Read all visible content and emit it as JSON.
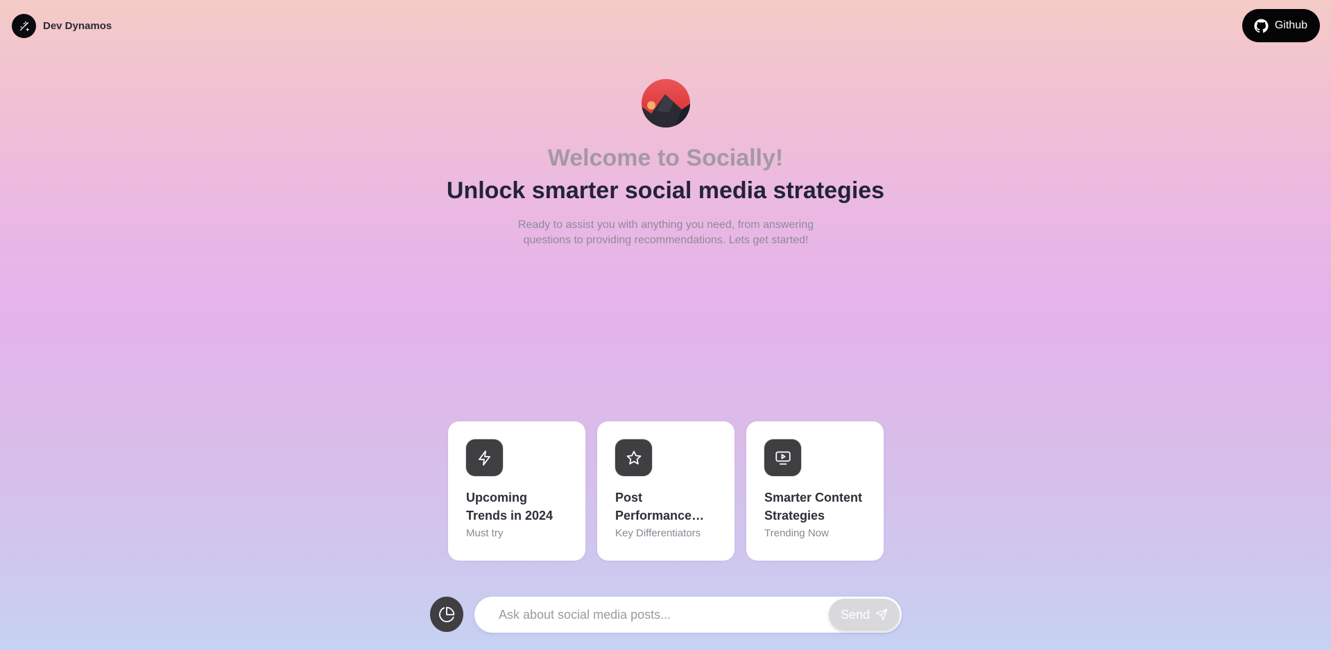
{
  "header": {
    "brand_name": "Dev Dynamos",
    "brand_icon": "magic-wand-icon",
    "github_label": "Github",
    "github_icon": "github-icon"
  },
  "hero": {
    "avatar": "mountain-sunset-avatar",
    "title": "Welcome to Socially!",
    "subtitle": "Unlock smarter social media strategies",
    "description": "Ready to assist you with anything you need, from answering questions to providing recommendations. Lets get started!"
  },
  "cards": [
    {
      "icon": "lightning-icon",
      "title": "Upcoming Trends in 2024",
      "subtitle": "Must try"
    },
    {
      "icon": "star-icon",
      "title": "Post Performance Tracking",
      "subtitle": "Key Differentiators"
    },
    {
      "icon": "video-screen-icon",
      "title": "Smarter Content Strategies",
      "subtitle": "Trending Now"
    }
  ],
  "composer": {
    "analytics_icon": "pie-chart-icon",
    "placeholder": "Ask about social media posts...",
    "value": "",
    "send_label": "Send",
    "send_icon": "send-icon"
  },
  "colors": {
    "dark": "#3f3f42",
    "black": "#050507",
    "title_muted": "#a398a6",
    "title_dark": "#23233a",
    "send_disabled": "#d9d9dc"
  }
}
